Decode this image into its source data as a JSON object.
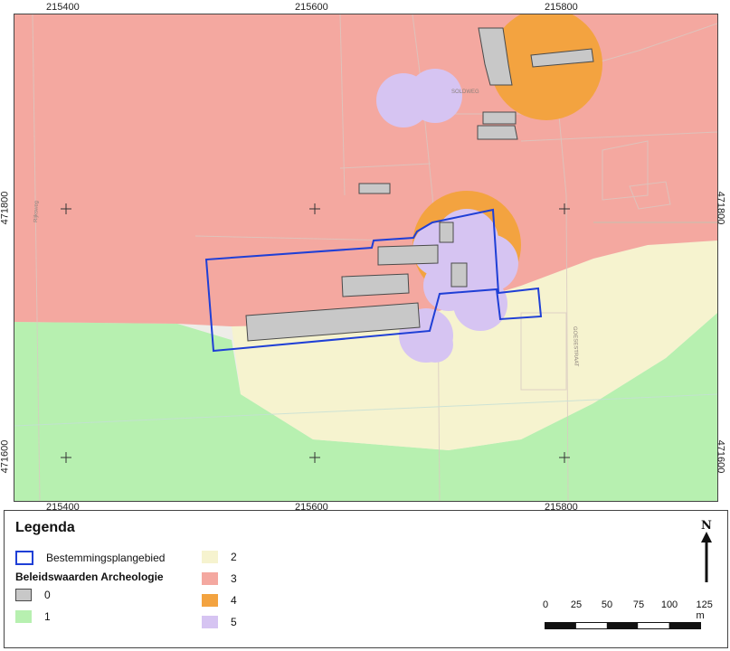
{
  "map": {
    "top_x_labels": [
      "215400",
      "215600",
      "215800"
    ],
    "bottom_x_labels": [
      "215400",
      "215600",
      "215800"
    ],
    "left_y_labels": [
      "471800",
      "471600"
    ],
    "right_y_labels": [
      "471800",
      "471600"
    ],
    "street_labels": [
      "SOLDWEG",
      "GOESESTRAAT",
      "Rijksweg"
    ]
  },
  "legend": {
    "title": "Legenda",
    "boundary_label": "Bestemmingsplangebied",
    "section_title": "Beleidswaarden Archeologie",
    "classes": [
      {
        "label": "0",
        "color": "#c8c8c8"
      },
      {
        "label": "1",
        "color": "#b7f0b0"
      },
      {
        "label": "2",
        "color": "#f6f3cf"
      },
      {
        "label": "3",
        "color": "#f4a8a0"
      },
      {
        "label": "4",
        "color": "#f3a340"
      },
      {
        "label": "5",
        "color": "#d6c4f2"
      }
    ],
    "boundary_color": "#1f3fd6"
  },
  "scalebar": {
    "labels": [
      "0",
      "25",
      "50",
      "75",
      "100",
      "125 m"
    ]
  },
  "north": {
    "letter": "N"
  }
}
